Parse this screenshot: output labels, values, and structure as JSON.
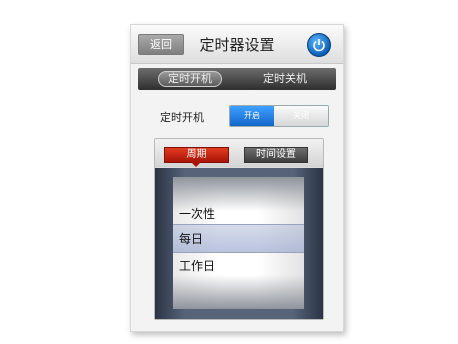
{
  "header": {
    "back_label": "返回",
    "title": "定时器设置"
  },
  "tabs": [
    {
      "label": "定时开机",
      "active": true
    },
    {
      "label": "定时关机",
      "active": false
    }
  ],
  "power_on_row": {
    "label": "定时开机",
    "toggle_on_label": "开启",
    "toggle_off_label": "关闭",
    "state": "on"
  },
  "panel": {
    "segments": [
      "周期",
      "时间设置"
    ],
    "picker_items": [
      "一次性",
      "每日",
      "工作日"
    ],
    "selected": "每日"
  },
  "colors": {
    "accent_blue": "#1a6fd4",
    "active_segment_red": "#c41e0d",
    "tab_dark": "#2e2e2e"
  }
}
